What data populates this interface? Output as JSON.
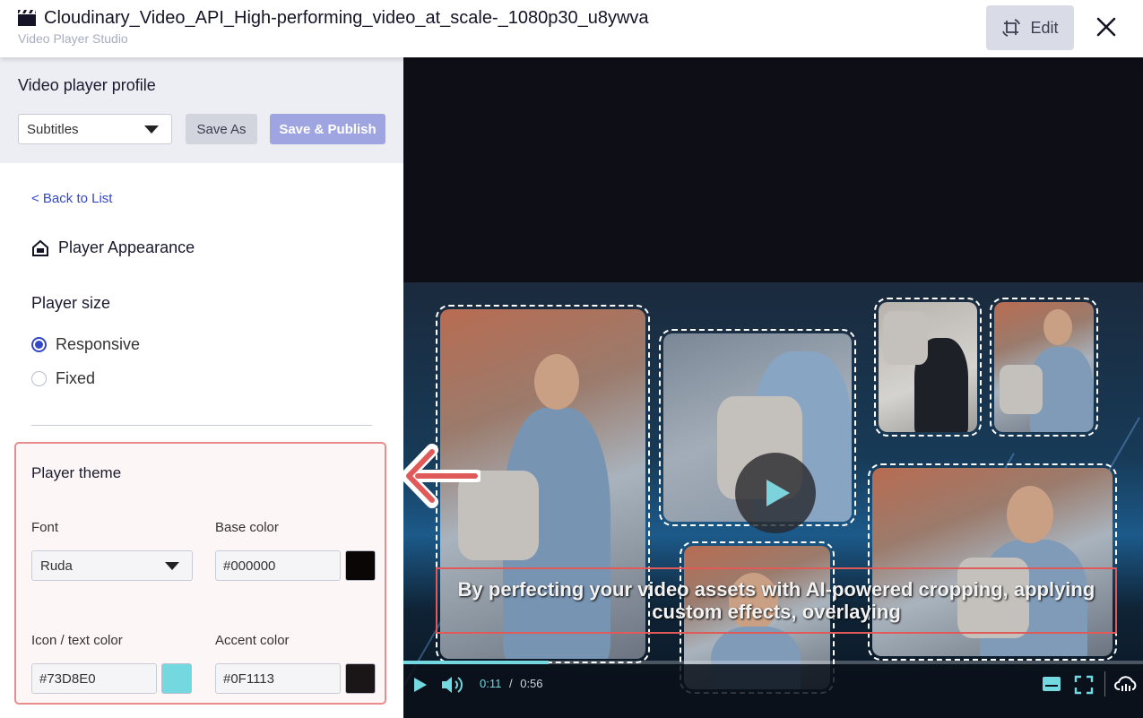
{
  "header": {
    "title": "Cloudinary_Video_API_High-performing_video_at_scale-_1080p30_u8ywva",
    "subtitle": "Video Player Studio",
    "edit_label": "Edit"
  },
  "profile": {
    "label": "Video player profile",
    "selected": "Subtitles",
    "save_as_label": "Save As",
    "publish_label": "Save & Publish"
  },
  "nav": {
    "back_label": "< Back to List",
    "section_title": "Player Appearance"
  },
  "player_size": {
    "label": "Player size",
    "options": [
      "Responsive",
      "Fixed"
    ],
    "selected": "Responsive"
  },
  "theme": {
    "title": "Player theme",
    "font_label": "Font",
    "font_value": "Ruda",
    "base_color_label": "Base color",
    "base_color_value": "#000000",
    "icon_color_label": "Icon / text color",
    "icon_color_value": "#73D8E0",
    "accent_color_label": "Accent color",
    "accent_color_value": "#0F1113"
  },
  "video": {
    "caption": "By perfecting your video assets with AI-powered cropping, applying custom effects, overlaying",
    "current_time": "0:11",
    "separator": "/",
    "duration": "0:56",
    "progress_fraction": 0.196
  },
  "colors": {
    "accent": "#3448C5",
    "swatch_base": "#0A0606",
    "swatch_icon": "#73D8E0",
    "swatch_accent": "#1A1516"
  }
}
